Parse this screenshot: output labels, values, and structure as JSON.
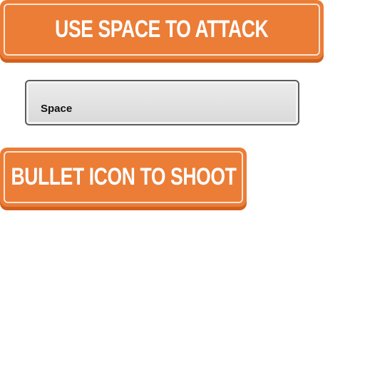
{
  "hints": {
    "attack_label": "USE SPACE TO ATTACK",
    "shoot_label": "BULLET ICON TO SHOOT"
  },
  "key": {
    "label": "Space"
  },
  "colors": {
    "banner": "#eb7d37",
    "banner_shadow": "#d2611f",
    "banner_outline": "#fbe3d2",
    "key_face": "#e3e3e3",
    "key_border": "#5c5c5c"
  }
}
